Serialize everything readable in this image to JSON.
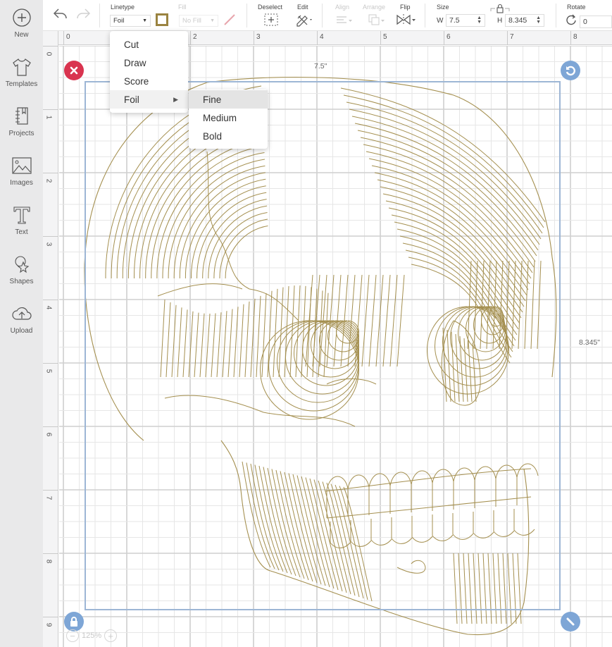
{
  "sidebar": {
    "items": [
      {
        "label": "New",
        "icon": "plus-circle-icon"
      },
      {
        "label": "Templates",
        "icon": "tshirt-icon"
      },
      {
        "label": "Projects",
        "icon": "notebook-icon"
      },
      {
        "label": "Images",
        "icon": "image-icon"
      },
      {
        "label": "Text",
        "icon": "text-t-icon"
      },
      {
        "label": "Shapes",
        "icon": "shapes-icon"
      },
      {
        "label": "Upload",
        "icon": "cloud-upload-icon"
      }
    ]
  },
  "toolbar": {
    "undo_icon": "undo-icon",
    "redo_icon": "redo-icon",
    "linetype": {
      "label": "Linetype",
      "value": "Foil",
      "swatch_color": "#9a8340"
    },
    "fill": {
      "label": "Fill",
      "value": "No Fill"
    },
    "deselect": {
      "label": "Deselect"
    },
    "edit": {
      "label": "Edit"
    },
    "align": {
      "label": "Align"
    },
    "arrange": {
      "label": "Arrange"
    },
    "flip": {
      "label": "Flip"
    },
    "size": {
      "label": "Size",
      "w_label": "W",
      "w_value": "7.5",
      "h_label": "H",
      "h_value": "8.345"
    },
    "rotate": {
      "label": "Rotate",
      "value": "0"
    }
  },
  "rulers": {
    "top": [
      "0",
      "1",
      "2",
      "3",
      "4",
      "5",
      "6",
      "7",
      "8"
    ],
    "left": [
      "0",
      "1",
      "2",
      "3",
      "4",
      "5",
      "6",
      "7",
      "8",
      "9"
    ]
  },
  "linetype_menu": {
    "items": [
      "Cut",
      "Draw",
      "Score",
      "Foil"
    ],
    "active": "Foil",
    "submenu": {
      "items": [
        "Fine",
        "Medium",
        "Bold"
      ],
      "highlighted": "Fine"
    }
  },
  "selection": {
    "width_label": "7.5\"",
    "height_label": "8.345\"",
    "delete_color": "#d9344f",
    "handle_color": "#7ea6d6"
  },
  "zoom": {
    "value": "125%"
  },
  "artwork": {
    "name": "skull-foil-illustration",
    "stroke_color": "#a48f4f"
  }
}
